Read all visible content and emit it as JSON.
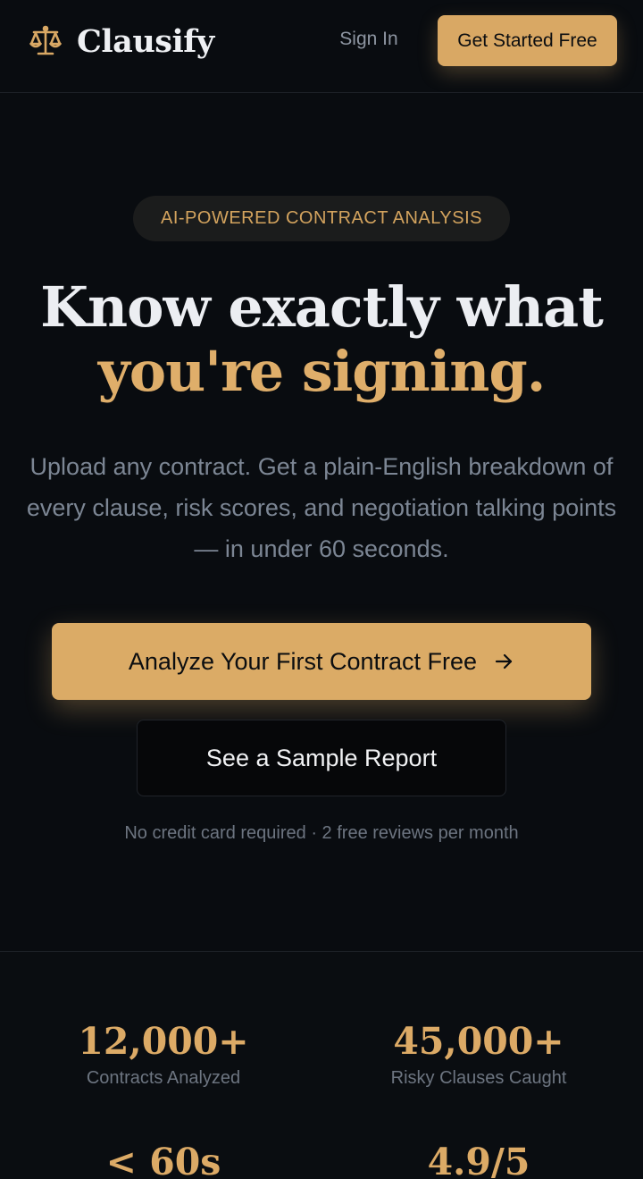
{
  "header": {
    "brand": "Clausify",
    "logo_icon": "scales-icon",
    "signin_label": "Sign In",
    "cta_label": "Get Started Free"
  },
  "hero": {
    "badge": "AI-POWERED CONTRACT ANALYSIS",
    "headline_line1": "Know exactly what",
    "headline_line2": "you're signing.",
    "subtext": "Upload any contract. Get a plain-English breakdown of every clause, risk scores, and negotiation talking points — in under 60 seconds.",
    "primary_cta": "Analyze Your First Contract Free",
    "primary_cta_icon": "arrow-right-icon",
    "secondary_cta": "See a Sample Report",
    "note": "No credit card required · 2 free reviews per month"
  },
  "stats": [
    {
      "value": "12,000+",
      "label": "Contracts Analyzed"
    },
    {
      "value": "45,000+",
      "label": "Risky Clauses Caught"
    },
    {
      "value": "< 60s",
      "label": ""
    },
    {
      "value": "4.9/5",
      "label": ""
    }
  ],
  "colors": {
    "background": "#090c10",
    "accent": "#dbab66",
    "text": "#eceef2",
    "muted": "#7c8694"
  }
}
